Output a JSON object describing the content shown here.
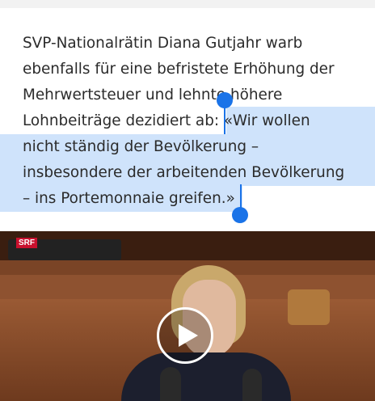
{
  "article": {
    "lines": [
      "SVP-Nationalrätin Diana Gutjahr warb",
      "ebenfalls für eine befristete Erhöhung der",
      "Mehrwertsteuer und lehnte höhere",
      "Lohnbeiträge dezidiert ab: «Wir wollen",
      "nicht ständig der Bevölkerung –",
      "insbesondere der arbeitenden Bevölkerung",
      "– ins Portemonnaie greifen.»"
    ],
    "line4_before": "Lohnbeiträge dezidiert ab: ",
    "line4_selected": "«Wir wollen"
  },
  "video": {
    "broadcaster_logo": "SRF",
    "play_icon": "play-icon"
  },
  "colors": {
    "selection": "#cfe3fb",
    "handle": "#1a73e8",
    "text": "#2b2b2b"
  }
}
